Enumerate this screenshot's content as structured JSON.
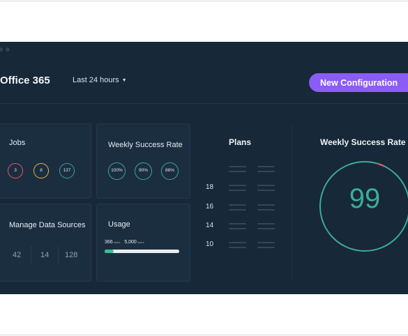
{
  "header": {
    "app_title": "Office 365",
    "time_range": "Last 24 hours",
    "cta_label": "New Configuration"
  },
  "jobs": {
    "title": "Jobs",
    "rings": [
      {
        "label": "3",
        "color": "#e0566b"
      },
      {
        "label": "8",
        "color": "#e8b53e"
      },
      {
        "label": "137",
        "color": "#3ba1a1"
      }
    ]
  },
  "weekly_rate": {
    "title": "Weekly Success Rate",
    "rings": [
      {
        "label": "100%"
      },
      {
        "label": "90%"
      },
      {
        "label": "88%"
      }
    ]
  },
  "data_sources": {
    "title": "Manage Data Sources",
    "values": [
      "42",
      "14",
      "128"
    ]
  },
  "usage": {
    "title": "Usage",
    "used": "366",
    "used_unit": "users",
    "total": "5,000",
    "total_unit": "users",
    "fill_fraction": 0.12
  },
  "plans": {
    "title": "Plans",
    "numbers": [
      "18",
      "16",
      "14",
      "10"
    ]
  },
  "gauge": {
    "title": "Weekly Success Rate",
    "value": "99",
    "fraction": 0.99,
    "color": "#3aae95",
    "remainder_color": "#e0566b"
  },
  "colors": {
    "background": "#172838",
    "card": "#1b2e40",
    "accent": "#8b5cf6",
    "success": "#34c38f"
  }
}
